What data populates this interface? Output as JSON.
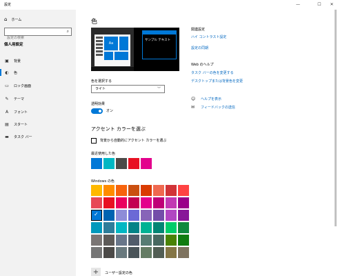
{
  "window": {
    "title": "設定",
    "min": "—",
    "max": "☐",
    "close": "✕"
  },
  "sidebar": {
    "home_label": "ホーム",
    "search_placeholder": "設定の検索",
    "section_title": "個人用設定",
    "items": [
      {
        "label": "背景",
        "icon": "picture-icon",
        "glyph": "▣"
      },
      {
        "label": "色",
        "icon": "palette-icon",
        "glyph": "◐"
      },
      {
        "label": "ロック画面",
        "icon": "lock-screen-icon",
        "glyph": "▭"
      },
      {
        "label": "テーマ",
        "icon": "brush-icon",
        "glyph": "✎"
      },
      {
        "label": "フォント",
        "icon": "font-icon",
        "glyph": "A"
      },
      {
        "label": "スタート",
        "icon": "start-icon",
        "glyph": "▤"
      },
      {
        "label": "タスク バー",
        "icon": "taskbar-icon",
        "glyph": "▬"
      }
    ]
  },
  "main": {
    "title": "色",
    "preview": {
      "tile_text": "Aa",
      "sample_text": "サンプル テキスト"
    },
    "choose_color_label": "色を選択する",
    "choose_color_value": "ライト",
    "transparency_label": "透明効果",
    "transparency_state": "オン",
    "accent_heading": "アクセント カラーを選ぶ",
    "auto_accent_label": "背景から自動的にアクセント カラーを選ぶ",
    "recent_label": "最近使用した色",
    "recent_colors": [
      "#0078d7",
      "#00b7c3",
      "#4c4a48",
      "#e81123",
      "#e3008c"
    ],
    "windows_colors_label": "Windows の色",
    "windows_colors": [
      "#ffb900",
      "#ff8c00",
      "#f7630c",
      "#ca5010",
      "#da3b01",
      "#ef6950",
      "#d13438",
      "#ff4343",
      "#e74856",
      "#e81123",
      "#ea005e",
      "#c30052",
      "#e3008c",
      "#bf0077",
      "#c239b3",
      "#9a0089",
      "#0078d7",
      "#0063b1",
      "#8e8cd8",
      "#6b69d6",
      "#8764b8",
      "#744da9",
      "#b146c2",
      "#881798",
      "#0099bc",
      "#2d7d9a",
      "#00b7c3",
      "#038387",
      "#00b294",
      "#018574",
      "#00cc6a",
      "#10893e",
      "#7a7574",
      "#5d5a58",
      "#68768a",
      "#515c6b",
      "#567c73",
      "#486860",
      "#498205",
      "#107c10",
      "#767676",
      "#4c4a48",
      "#69797e",
      "#4a5459",
      "#647c64",
      "#525e54",
      "#847545",
      "#7e735f"
    ],
    "selected_index": 16,
    "custom_label": "ユーザー設定の色"
  },
  "related": {
    "title": "関連設定",
    "links": [
      "ハイ コントラスト設定",
      "設定の同期"
    ],
    "web_help_title": "Web のヘルプ",
    "web_links": [
      "タスク バーの色を変更する",
      "デスクトップまたは背景色を変更"
    ],
    "help": [
      {
        "label": "ヘルプを表示",
        "icon": "help-icon",
        "glyph": "☺"
      },
      {
        "label": "フィードバックの送信",
        "icon": "feedback-icon",
        "glyph": "✉"
      }
    ]
  }
}
